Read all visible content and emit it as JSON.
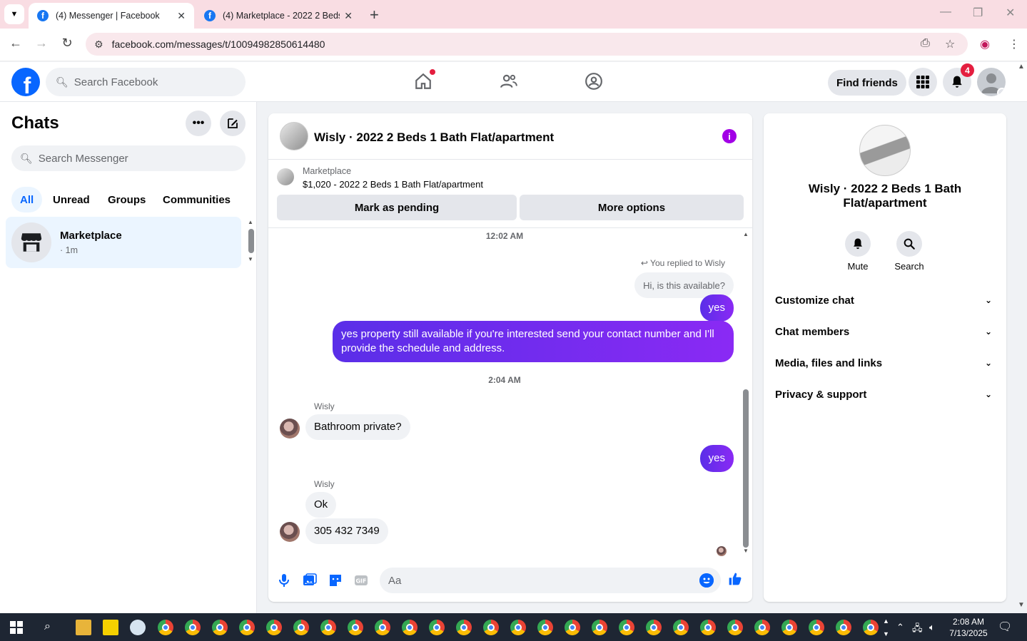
{
  "browser": {
    "tabs": [
      {
        "title": "(4) Messenger | Facebook",
        "active": true
      },
      {
        "title": "(4) Marketplace - 2022 2 Beds 1",
        "active": false
      }
    ],
    "url": "facebook.com/messages/t/10094982850614480"
  },
  "fb": {
    "search_placeholder": "Search Facebook",
    "find_friends": "Find friends",
    "notification_count": "4"
  },
  "sidebar": {
    "title": "Chats",
    "search_placeholder": "Search Messenger",
    "filters": [
      "All",
      "Unread",
      "Groups",
      "Communities"
    ],
    "active_filter": "All",
    "chats": [
      {
        "name": "Marketplace",
        "time": "· 1m"
      }
    ]
  },
  "chat": {
    "title": "Wisly · 2022 2 Beds 1 Bath Flat/apartment",
    "marketplace_label": "Marketplace",
    "listing": "$1,020 - 2022 2 Beds 1 Bath Flat/apartment",
    "btn_pending": "Mark as pending",
    "btn_more": "More options",
    "stamp1": "12:02 AM",
    "replied_to": "You replied to Wisly",
    "quoted": "Hi, is this available?",
    "out1": "yes",
    "out2": "yes property still available if you're interested send your contact number and I'll provide the schedule and address.",
    "stamp2": "2:04 AM",
    "sender": "Wisly",
    "in1": "Bathroom private?",
    "out3": "yes",
    "in2": "Ok",
    "in3": "305 432 7349",
    "composer_placeholder": "Aa"
  },
  "info": {
    "name": "Wisly · 2022 2 Beds 1 Bath Flat/apartment",
    "actions": [
      "Mute",
      "Search"
    ],
    "sections": [
      "Customize chat",
      "Chat members",
      "Media, files and links",
      "Privacy & support"
    ]
  },
  "taskbar": {
    "time": "2:08 AM",
    "date": "7/13/2025"
  },
  "colors": {
    "fb_blue": "#0866ff",
    "accent_purple": "#6a2ff0",
    "notification_red": "#e41e3f"
  }
}
